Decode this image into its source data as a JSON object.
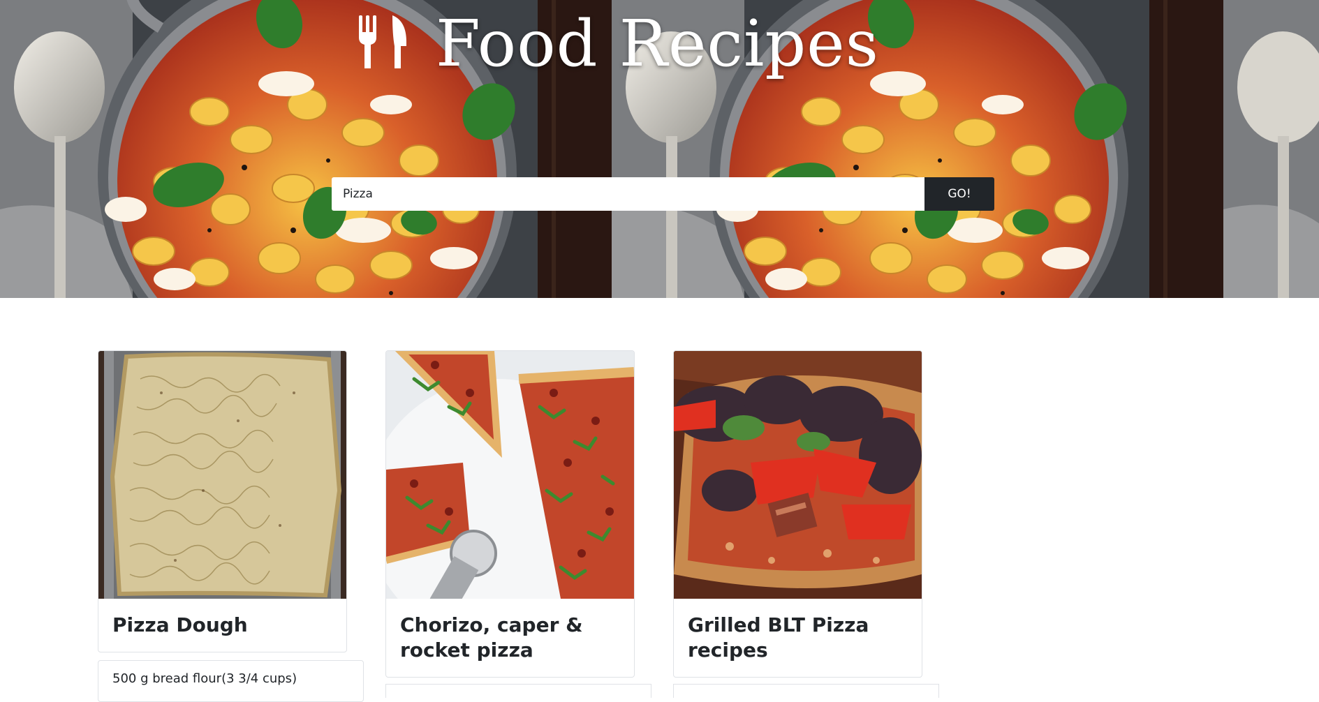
{
  "header": {
    "title": "Food Recipes",
    "logo_icon": "fork-knife-icon"
  },
  "search": {
    "value": "Pizza",
    "button_label": "GO!"
  },
  "recipes": [
    {
      "title": "Pizza Dough"
    },
    {
      "title": "Chorizo, caper & rocket pizza"
    },
    {
      "title": "Grilled BLT Pizza recipes"
    }
  ],
  "ingredients": [
    {
      "text": "500 g bread flour(3 3/4 cups)"
    }
  ],
  "colors": {
    "button_bg": "#212529",
    "text": "#212529",
    "card_border": "#dfe2e6"
  }
}
